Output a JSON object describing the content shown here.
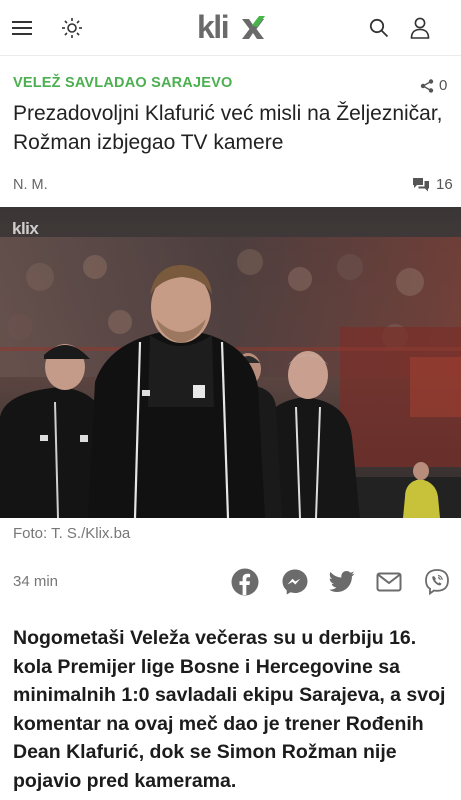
{
  "header": {
    "logo_text": "klix",
    "icons": [
      "menu-icon",
      "sun-icon",
      "search-icon",
      "user-icon"
    ]
  },
  "article": {
    "kicker": "VELEŽ SAVLADAO SARAJEVO",
    "share_count": "0",
    "headline": "Prezadovoljni Klafurić već misli na Željezničar, Rožman izbjegao TV kamere",
    "author": "N. M.",
    "comment_count": "16",
    "photo_watermark": "klix",
    "photo_caption": "Foto: T. S./Klix.ba",
    "time_ago": "34 min",
    "lead": "Nogometaši Veleža večeras su u derbiju 16. kola Premijer lige Bosne i Hercegovine sa minimalnih 1:0 savladali ekipu Sarajeva, a svoj komentar na ovaj meč dao je trener Rođenih Dean Klafurić, dok se Simon Rožman nije pojavio pred kamerama."
  },
  "colors": {
    "kicker": "#4caf50",
    "icon_grey": "#6b6b6b",
    "text_dark": "#1c1c1c"
  },
  "social_icons": [
    "facebook-icon",
    "messenger-icon",
    "twitter-icon",
    "mail-icon",
    "viber-icon"
  ]
}
